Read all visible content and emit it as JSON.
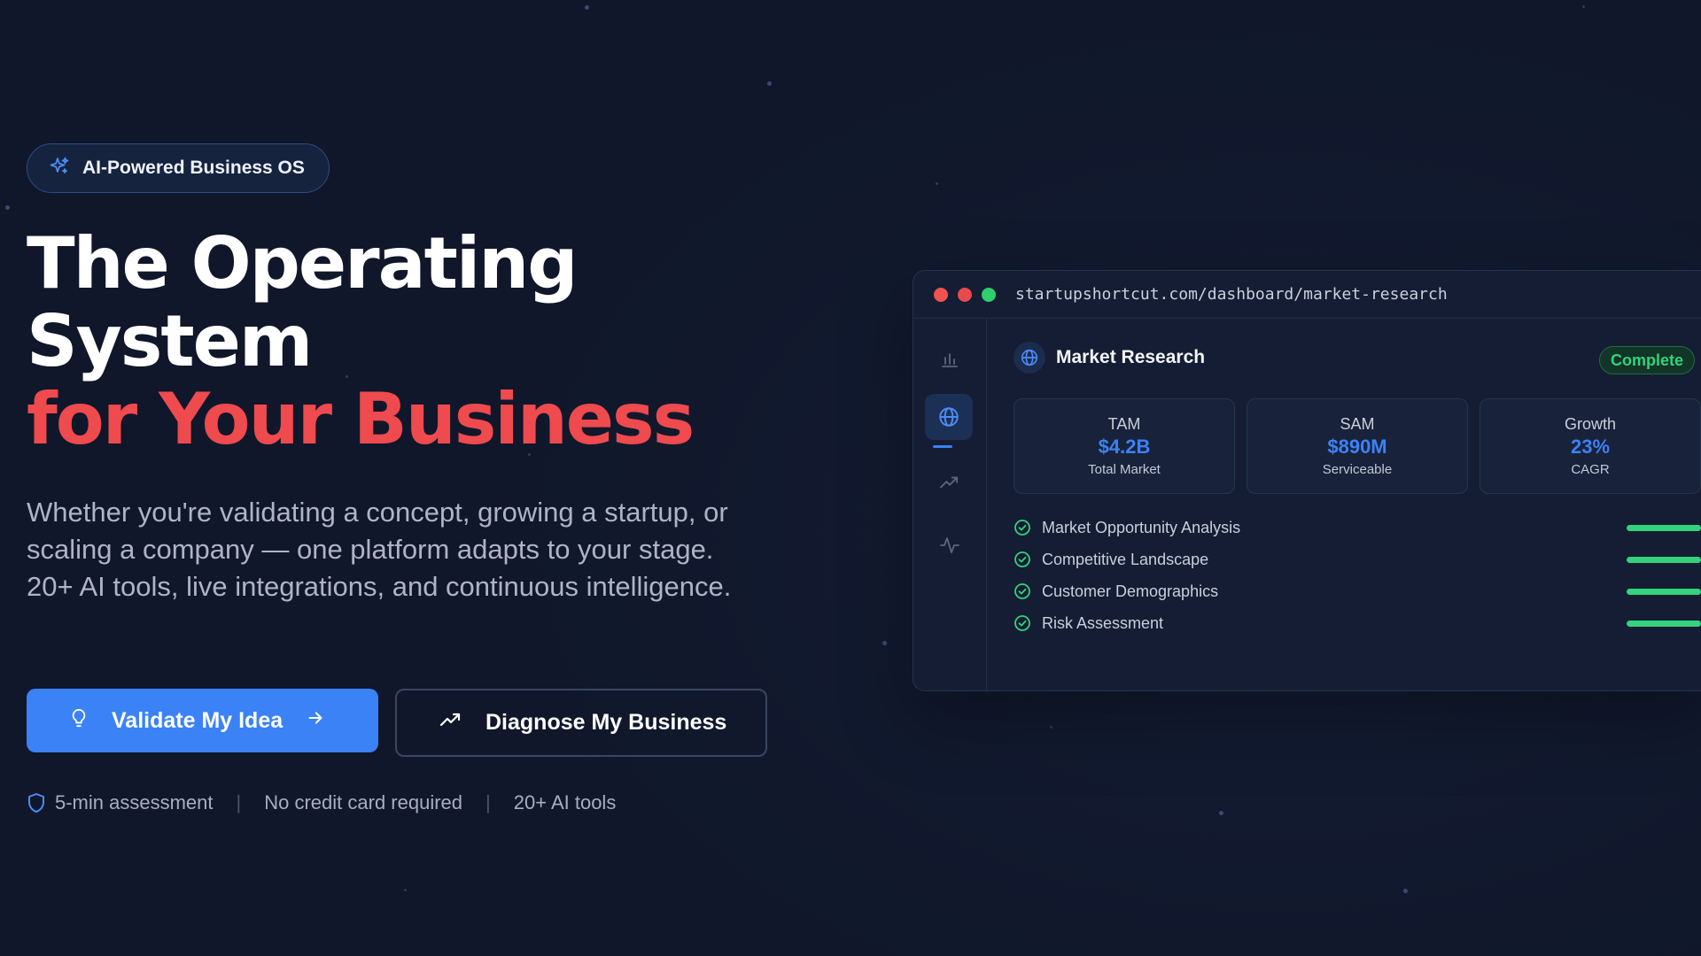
{
  "hero": {
    "badge": "AI-Powered Business OS",
    "headline_line1": "The Operating",
    "headline_line2": "System",
    "headline_line3": "for Your Business",
    "subheadline": "Whether you're validating a concept, growing a startup, or scaling a company — one platform adapts to your stage. 20+ AI tools, live integrations, and continuous intelligence.",
    "primary_cta": "Validate My Idea",
    "secondary_cta": "Diagnose My Business",
    "trust": [
      "5-min assessment",
      "No credit card required",
      "20+ AI tools"
    ]
  },
  "mockup": {
    "url": "startupshortcut.com/dashboard/market-research",
    "panel_title": "Market Research",
    "status": "Complete",
    "metrics": [
      {
        "label": "TAM",
        "value": "$4.2B",
        "caption": "Total Market"
      },
      {
        "label": "SAM",
        "value": "$890M",
        "caption": "Serviceable"
      },
      {
        "label": "Growth",
        "value": "23%",
        "caption": "CAGR"
      }
    ],
    "checklist": [
      "Market Opportunity Analysis",
      "Competitive Landscape",
      "Customer Demographics",
      "Risk Assessment"
    ]
  },
  "icons": {
    "badge": "sparkle-icon",
    "primary_cta": "lightbulb-icon",
    "primary_cta_trailing": "arrow-right-icon",
    "secondary_cta": "trending-up-icon",
    "trust": "shield-icon",
    "sidebar": [
      "bar-chart-icon",
      "globe-icon",
      "trending-up-icon",
      "activity-icon"
    ],
    "checklist": "check-circle-icon"
  },
  "colors": {
    "background": "#10172a",
    "accent_blue": "#3b82f6",
    "headline_red": "#ef4a4e",
    "success_green": "#34d27a"
  }
}
